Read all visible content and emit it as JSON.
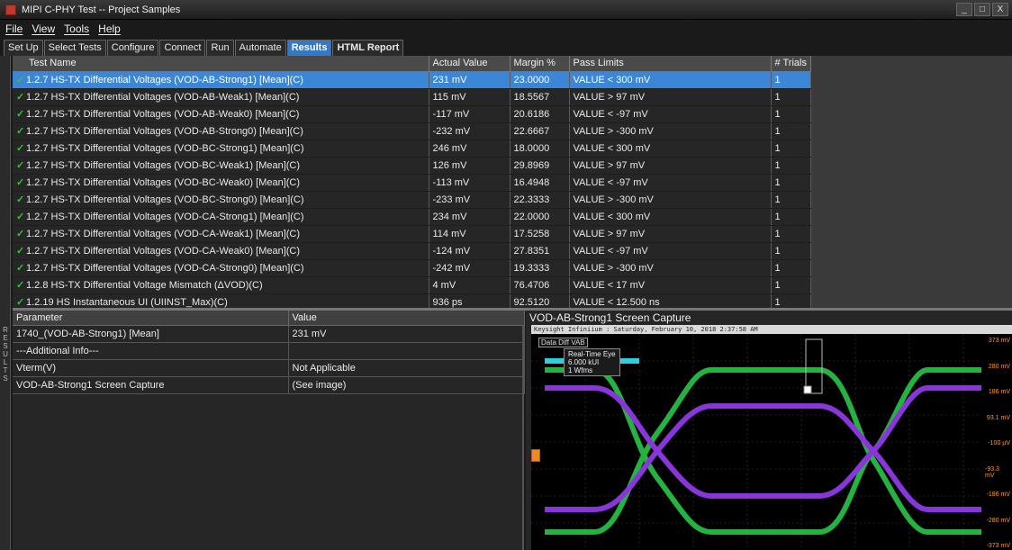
{
  "window": {
    "title": "MIPI C-PHY Test -- Project Samples"
  },
  "menu": [
    "File",
    "View",
    "Tools",
    "Help"
  ],
  "tabs": [
    "Set Up",
    "Select Tests",
    "Configure",
    "Connect",
    "Run",
    "Automate",
    "Results",
    "HTML Report"
  ],
  "active_tab": "Results",
  "side_rail_label": "RESULTS",
  "results_table": {
    "headers": [
      "Test Name",
      "Actual Value",
      "Margin %",
      "Pass Limits",
      "# Trials"
    ],
    "rows": [
      [
        "1.2.7 HS-TX Differential Voltages (VOD-AB-Strong1) [Mean](C)",
        "231 mV",
        "23.0000",
        "VALUE < 300 mV",
        "1"
      ],
      [
        "1.2.7 HS-TX Differential Voltages (VOD-AB-Weak1) [Mean](C)",
        "115 mV",
        "18.5567",
        "VALUE > 97 mV",
        "1"
      ],
      [
        "1.2.7 HS-TX Differential Voltages (VOD-AB-Weak0) [Mean](C)",
        "-117 mV",
        "20.6186",
        "VALUE < -97 mV",
        "1"
      ],
      [
        "1.2.7 HS-TX Differential Voltages (VOD-AB-Strong0) [Mean](C)",
        "-232 mV",
        "22.6667",
        "VALUE > -300 mV",
        "1"
      ],
      [
        "1.2.7 HS-TX Differential Voltages (VOD-BC-Strong1) [Mean](C)",
        "246 mV",
        "18.0000",
        "VALUE < 300 mV",
        "1"
      ],
      [
        "1.2.7 HS-TX Differential Voltages (VOD-BC-Weak1) [Mean](C)",
        "126 mV",
        "29.8969",
        "VALUE > 97 mV",
        "1"
      ],
      [
        "1.2.7 HS-TX Differential Voltages (VOD-BC-Weak0) [Mean](C)",
        "-113 mV",
        "16.4948",
        "VALUE < -97 mV",
        "1"
      ],
      [
        "1.2.7 HS-TX Differential Voltages (VOD-BC-Strong0) [Mean](C)",
        "-233 mV",
        "22.3333",
        "VALUE > -300 mV",
        "1"
      ],
      [
        "1.2.7 HS-TX Differential Voltages (VOD-CA-Strong1) [Mean](C)",
        "234 mV",
        "22.0000",
        "VALUE < 300 mV",
        "1"
      ],
      [
        "1.2.7 HS-TX Differential Voltages (VOD-CA-Weak1) [Mean](C)",
        "114 mV",
        "17.5258",
        "VALUE > 97 mV",
        "1"
      ],
      [
        "1.2.7 HS-TX Differential Voltages (VOD-CA-Weak0) [Mean](C)",
        "-124 mV",
        "27.8351",
        "VALUE < -97 mV",
        "1"
      ],
      [
        "1.2.7 HS-TX Differential Voltages (VOD-CA-Strong0) [Mean](C)",
        "-242 mV",
        "19.3333",
        "VALUE > -300 mV",
        "1"
      ],
      [
        "1.2.8 HS-TX Differential Voltage Mismatch (ΔVOD)(C)",
        "4 mV",
        "76.4706",
        "VALUE < 17 mV",
        "1"
      ],
      [
        "1.2.19 HS Instantaneous UI (UIINST_Max)(C)",
        "936 ps",
        "92.5120",
        "VALUE < 12.500 ns",
        "1"
      ]
    ],
    "selected_row": 0
  },
  "params_table": {
    "headers": [
      "Parameter",
      "Value"
    ],
    "rows": [
      [
        "1740_(VOD-AB-Strong1) [Mean]",
        "231 mV"
      ],
      [
        "---Additional Info---",
        ""
      ],
      [
        "Vterm(V)",
        "Not Applicable"
      ],
      [
        "VOD-AB-Strong1 Screen Capture",
        "(See image)"
      ]
    ]
  },
  "capture": {
    "title": "VOD-AB-Strong1 Screen Capture",
    "scope_header": "Keysight Infiniium : Saturday, February 10, 2018 2:37:58 AM",
    "meas_tag": "Data Diff VAB",
    "meas_box": [
      "Real-Time Eye",
      "6.000 kUI",
      "1 Wfms"
    ],
    "y_ticks": [
      "373 mV",
      "280 mV",
      "186 mV",
      "93.1 mV",
      "-100 µV",
      "-93.3 mV",
      "-186 mV",
      "-280 mV",
      "-373 mV"
    ]
  }
}
